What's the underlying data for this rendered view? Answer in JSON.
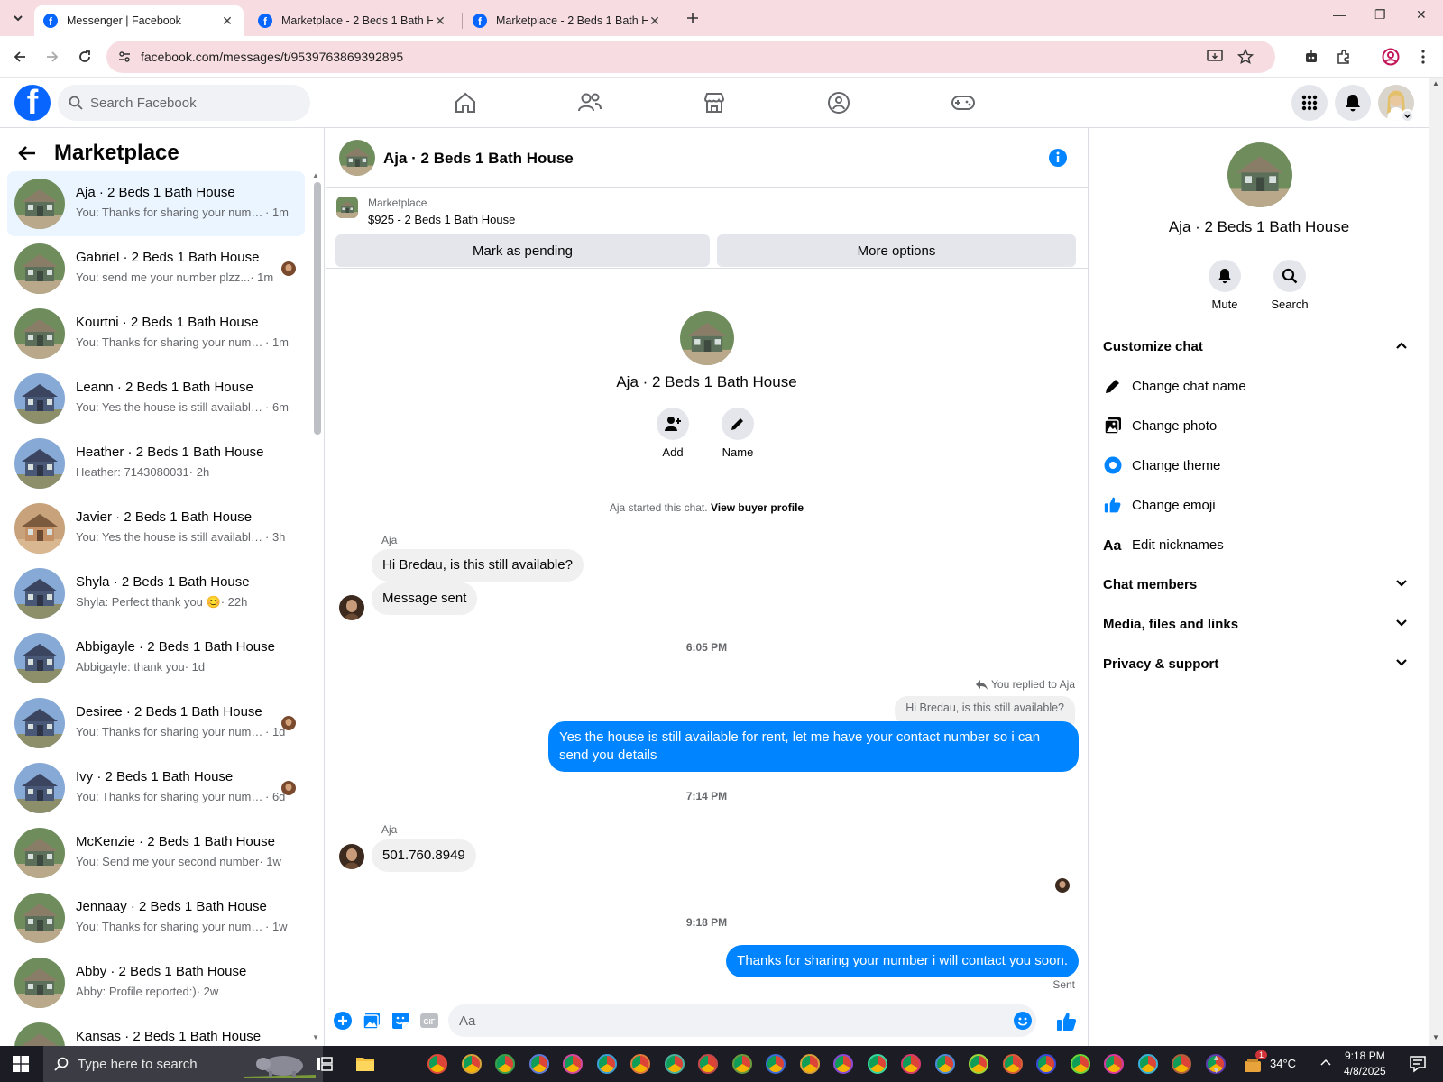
{
  "browser": {
    "tabs": [
      {
        "title": "Messenger | Facebook"
      },
      {
        "title": "Marketplace - 2 Beds 1 Bath House"
      },
      {
        "title": "Marketplace - 2 Beds 1 Bath House"
      }
    ],
    "url": "facebook.com/messages/t/9539763869392895"
  },
  "fb": {
    "search_placeholder": "Search Facebook"
  },
  "left": {
    "title": "Marketplace",
    "chats": [
      {
        "name": "Aja · 2 Beds 1 Bath House",
        "snippet": "You: Thanks for sharing your number i will contact you soon.",
        "time": " · 1m",
        "selected": true,
        "thumb": "green"
      },
      {
        "name": "Gabriel · 2 Beds 1 Bath House",
        "snippet": "You: send me your number plzz...",
        "time": " · 1m",
        "seen": true,
        "thumb": "green"
      },
      {
        "name": "Kourtni · 2 Beds 1 Bath House",
        "snippet": "You: Thanks for sharing your number i will contact you soon.",
        "time": " · 1m",
        "thumb": "green"
      },
      {
        "name": "Leann · 2 Beds 1 Bath House",
        "snippet": "You: Yes the house is still available for rent.",
        "time": " · 6m",
        "thumb": "blue"
      },
      {
        "name": "Heather · 2 Beds 1 Bath House",
        "snippet": "Heather: 7143080031",
        "time": " · 2h",
        "thumb": "blue"
      },
      {
        "name": "Javier · 2 Beds 1 Bath House",
        "snippet": "You: Yes the house is still available for rent.",
        "time": " · 3h",
        "thumb": "brown"
      },
      {
        "name": "Shyla · 2 Beds 1 Bath House",
        "snippet": "Shyla: Perfect thank you 😊",
        "time": " · 22h",
        "thumb": "blue"
      },
      {
        "name": "Abbigayle · 2 Beds 1 Bath House",
        "snippet": "Abbigayle: thank you",
        "time": " · 1d",
        "thumb": "blue"
      },
      {
        "name": "Desiree · 2 Beds 1 Bath House",
        "snippet": "You: Thanks for sharing your number",
        "time": " · 1d",
        "seen": true,
        "thumb": "blue"
      },
      {
        "name": "Ivy · 2 Beds 1 Bath House",
        "snippet": "You: Thanks for sharing your number",
        "time": " · 6d",
        "seen": true,
        "thumb": "blue"
      },
      {
        "name": "McKenzie · 2 Beds 1 Bath House",
        "snippet": "You: Send me your second number",
        "time": " · 1w",
        "thumb": "green"
      },
      {
        "name": "Jennaay · 2 Beds 1 Bath House",
        "snippet": "You: Thanks for sharing your number i will contact you soon.",
        "time": " · 1w",
        "thumb": "green"
      },
      {
        "name": "Abby · 2 Beds 1 Bath House",
        "snippet": "Abby: Profile reported:)",
        "time": " · 2w",
        "thumb": "green"
      },
      {
        "name": "Kansas · 2 Beds 1 Bath House",
        "snippet": "",
        "time": "",
        "thumb": "green"
      }
    ]
  },
  "conv": {
    "title": "Aja · 2 Beds 1 Bath House",
    "listing_label": "Marketplace",
    "listing_price": "$925 - 2 Beds 1 Bath House",
    "mark_pending": "Mark as pending",
    "more_options": "More options",
    "contact_name": "Aja · 2 Beds 1 Bath House",
    "add_label": "Add",
    "name_label": "Name",
    "started_text": "Aja started this chat.",
    "view_profile": "View buyer profile",
    "sender": "Aja",
    "msg1": "Hi Bredau, is this still available?",
    "msg2": "Message sent",
    "time1": "6:05 PM",
    "replied_label": "You replied to Aja",
    "quoted": "Hi Bredau, is this still available?",
    "msg3": "Yes the house is still available for rent, let me have your contact number so i can send you details",
    "time2": "7:14 PM",
    "msg4": "501.760.8949",
    "time3": "9:18 PM",
    "msg5": "Thanks for sharing your number i will contact you soon.",
    "sent_label": "Sent",
    "input_placeholder": "Aa"
  },
  "right": {
    "name": "Aja · 2 Beds 1 Bath House",
    "mute": "Mute",
    "search": "Search",
    "customize": "Customize chat",
    "change_name": "Change chat name",
    "change_photo": "Change photo",
    "change_theme": "Change theme",
    "change_emoji": "Change emoji",
    "edit_nicknames": "Edit nicknames",
    "members": "Chat members",
    "media": "Media, files and links",
    "privacy": "Privacy & support"
  },
  "taskbar": {
    "search_placeholder": "Type here to search",
    "temperature": "34°C",
    "time": "9:18 PM",
    "date": "4/8/2025",
    "notification_count": "1"
  },
  "colors": {
    "accent": "#0084ff",
    "fb_blue": "#0866ff",
    "tab_strip": "#f7dde2"
  }
}
